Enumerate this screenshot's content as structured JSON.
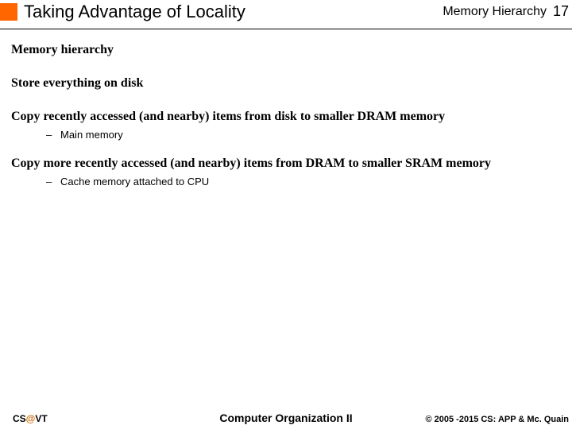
{
  "header": {
    "title": "Taking Advantage of Locality",
    "chapter": "Memory Hierarchy",
    "page": "17"
  },
  "body": {
    "heading": "Memory hierarchy",
    "line1": "Store everything on disk",
    "line2": "Copy recently accessed (and nearby) items from disk to smaller DRAM memory",
    "sub2": "Main memory",
    "line3": "Copy more recently accessed (and nearby) items from DRAM to smaller SRAM memory",
    "sub3": "Cache memory attached to CPU"
  },
  "footer": {
    "left_cs": "CS",
    "left_at": "@",
    "left_vt": "VT",
    "center": "Computer Organization II",
    "right": "© 2005 -2015 CS: APP & Mc. Quain"
  }
}
